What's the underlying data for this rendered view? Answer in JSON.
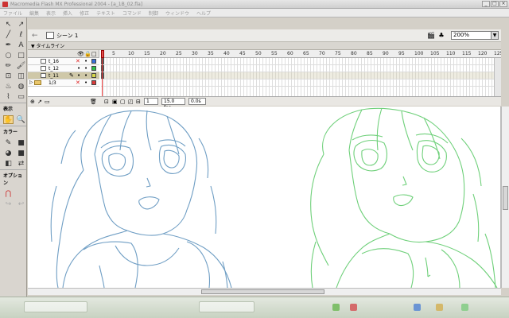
{
  "window": {
    "title": "Macromedia Flash MX Professional 2004 - [a_1B_02.fla]"
  },
  "menu": [
    "ファイル",
    "編集",
    "表示",
    "挿入",
    "修正",
    "テキスト",
    "コマンド",
    "制御",
    "ウィンドウ",
    "ヘルプ"
  ],
  "toolbox": {
    "sections": {
      "view": "表示",
      "color": "カラー",
      "options": "オプション"
    }
  },
  "editbar": {
    "scene_label": "シーン 1",
    "zoom": "200%"
  },
  "timeline": {
    "header_label": "▼ タイムライン",
    "frame_numbers": [
      "5",
      "10",
      "15",
      "20",
      "25",
      "30",
      "35",
      "40",
      "45",
      "50",
      "55",
      "60",
      "65",
      "70",
      "75",
      "80",
      "85",
      "90",
      "95",
      "100",
      "105",
      "110",
      "115",
      "120",
      "125"
    ],
    "layers": [
      {
        "name": "t_16",
        "type": "layer",
        "selected": false,
        "color": "#3a6fd8"
      },
      {
        "name": "t_12",
        "type": "layer",
        "selected": false,
        "color": "#2fbf4a"
      },
      {
        "name": "t_11",
        "type": "layer",
        "selected": true,
        "color": "#d8d84a"
      },
      {
        "name": "1/3",
        "type": "folder",
        "selected": false,
        "color": "#d83a3a"
      }
    ],
    "footer": {
      "current_frame": "1",
      "fps": "15.0 fps",
      "elapsed": "0.0s"
    }
  },
  "colors": {
    "left_drawing": "#6f9ec4",
    "right_drawing": "#6fd07a",
    "selection": "#cfc8a8"
  }
}
